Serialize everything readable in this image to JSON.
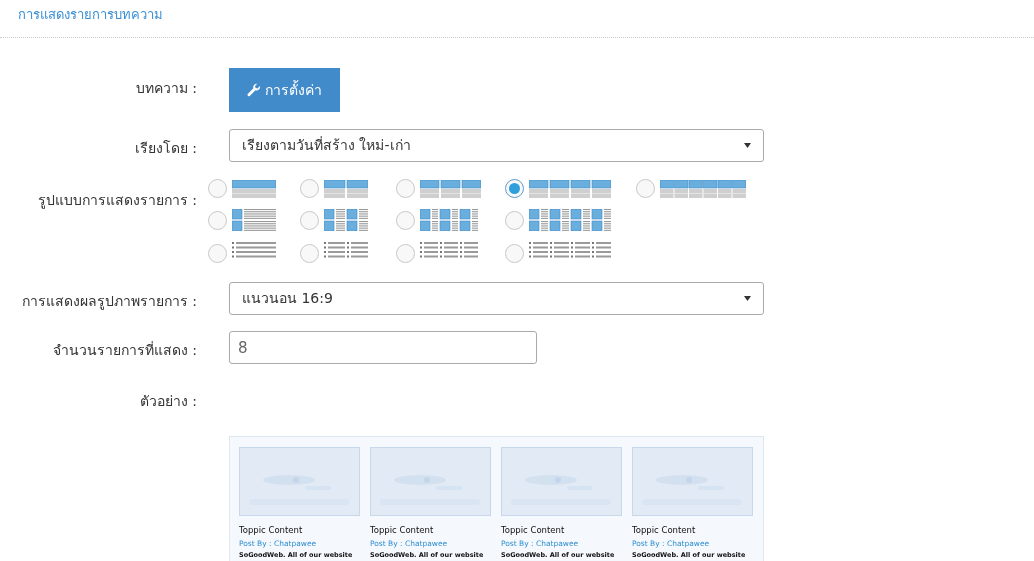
{
  "header": {
    "title": "การแสดงรายการบทความ"
  },
  "article": {
    "label": "บทความ :",
    "button": "การตั้งค่า"
  },
  "sort": {
    "label": "เรียงโดย :",
    "value": "เรียงตามวันที่สร้าง ใหม่-เก่า"
  },
  "layout": {
    "label": "รูปแบบการแสดงรายการ :",
    "options": [
      {
        "kind": "card",
        "selected": false
      },
      {
        "kind": "card",
        "selected": false
      },
      {
        "kind": "card",
        "selected": false
      },
      {
        "kind": "card",
        "selected": true
      },
      {
        "kind": "card",
        "selected": false
      },
      {
        "kind": "thumb",
        "selected": false
      },
      {
        "kind": "thumb",
        "selected": false
      },
      {
        "kind": "thumb",
        "selected": false
      },
      {
        "kind": "thumb",
        "selected": false
      },
      {
        "kind": "bullet",
        "selected": false
      },
      {
        "kind": "bullet",
        "selected": false
      },
      {
        "kind": "bullet",
        "selected": false
      },
      {
        "kind": "bullet",
        "selected": false
      }
    ]
  },
  "image_display": {
    "label": "การแสดงผลรูปภาพรายการ :",
    "value": "แนวนอน 16:9"
  },
  "count": {
    "label": "จำนวนรายการที่แสดง :",
    "value": "8"
  },
  "preview": {
    "label": "ตัวอย่าง :",
    "items": [
      {
        "kind": "picture",
        "title": "Toppic Content",
        "byline": "Post By : Chatpawee",
        "excerpt": "SoGoodWeb. All of our website"
      },
      {
        "kind": "picture",
        "title": "Toppic Content",
        "byline": "Post By : Chatpawee",
        "excerpt": "SoGoodWeb. All of our website"
      },
      {
        "kind": "picture",
        "title": "Toppic Content",
        "byline": "Post By : Chatpawee",
        "excerpt": "SoGoodWeb. All of our website"
      },
      {
        "kind": "picture",
        "title": "Toppic Content",
        "byline": "Post By : Chatpawee",
        "excerpt": "SoGoodWeb. All of our website"
      }
    ]
  }
}
